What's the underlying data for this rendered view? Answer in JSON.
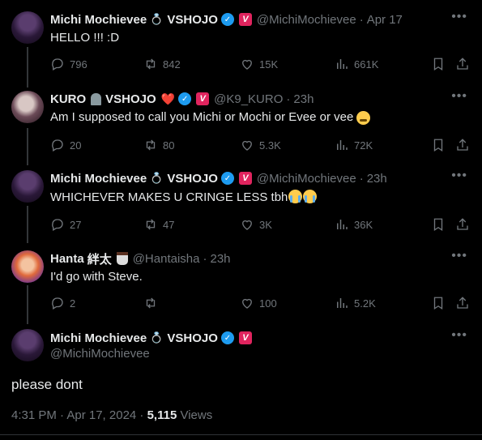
{
  "tweets": [
    {
      "name": "Michi Mochievee",
      "org": "VSHOJO",
      "handle": "@MichiMochievee",
      "time": "Apr 17",
      "text": "HELLO !!! :D",
      "replies": "796",
      "retweets": "842",
      "likes": "15K",
      "views": "661K"
    },
    {
      "name": "KURO",
      "org": "VSHOJO",
      "handle": "@K9_KURO",
      "time": "23h",
      "text": "Am I supposed to call you Michi or Mochi or Evee or vee",
      "replies": "20",
      "retweets": "80",
      "likes": "5.3K",
      "views": "72K"
    },
    {
      "name": "Michi Mochievee",
      "org": "VSHOJO",
      "handle": "@MichiMochievee",
      "time": "23h",
      "text": "WHICHEVER MAKES U CRINGE LESS tbh",
      "replies": "27",
      "retweets": "47",
      "likes": "3K",
      "views": "36K"
    },
    {
      "name": "Hanta",
      "name_suffix": "絆太",
      "handle": "@Hantaisha",
      "time": "23h",
      "text": "I'd go with Steve.",
      "replies": "2",
      "retweets": "",
      "likes": "100",
      "views": "5.2K"
    }
  ],
  "main_tweet": {
    "name": "Michi Mochievee",
    "org": "VSHOJO",
    "handle": "@MichiMochievee",
    "text": "please dont",
    "timestamp": "4:31 PM · Apr 17, 2024 · ",
    "views_count": "5,115",
    "views_label": " Views"
  },
  "icons": {
    "more": "more-icon",
    "reply": "reply-icon",
    "retweet": "retweet-icon",
    "like": "heart-icon",
    "views": "views-icon",
    "bookmark": "bookmark-icon",
    "share": "share-icon"
  },
  "colors": {
    "background": "#000000",
    "text": "#e7e9ea",
    "muted": "#71767b",
    "verified": "#1d9bf0",
    "vshojo_badge": "#e0245e"
  }
}
